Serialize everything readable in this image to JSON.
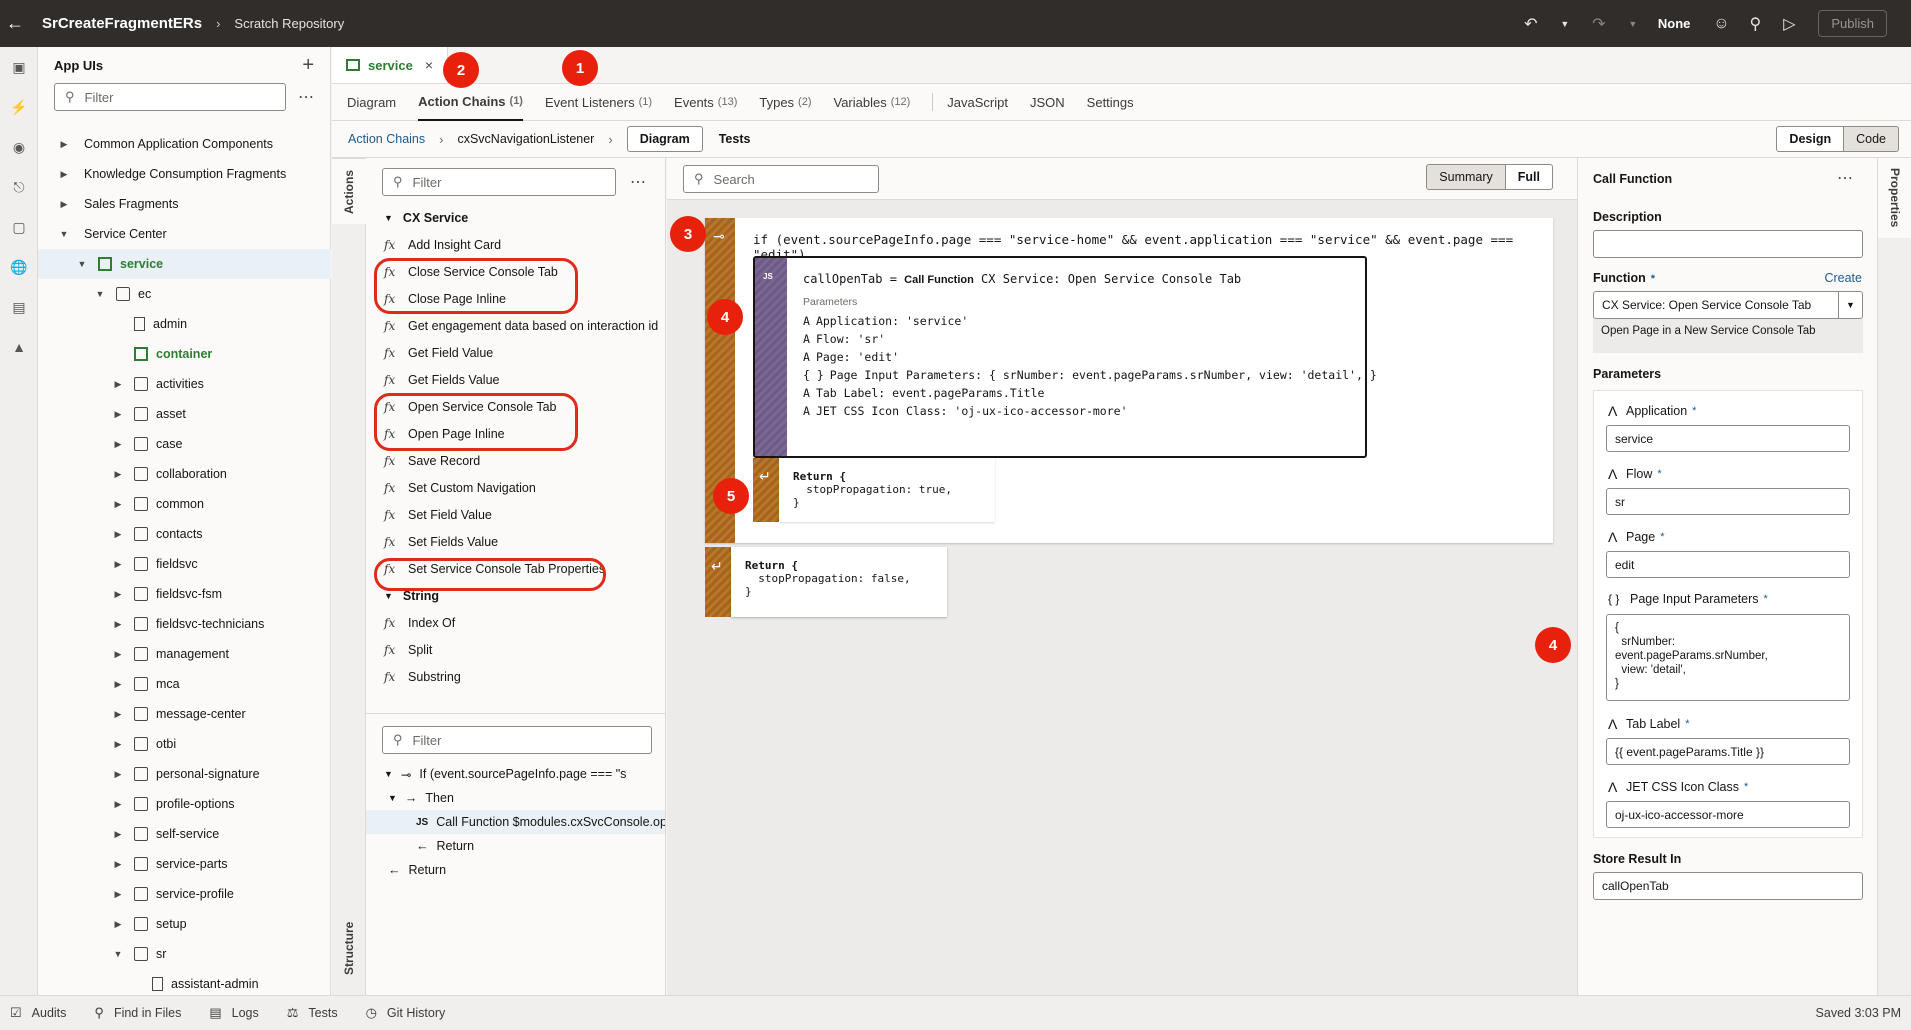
{
  "topbar": {
    "app_name": "SrCreateFragmentERs",
    "repo": "Scratch Repository",
    "none_label": "None",
    "publish_label": "Publish"
  },
  "app_panel": {
    "title": "App UIs",
    "filter_placeholder": "Filter",
    "tree": [
      {
        "label": "Common Application Components",
        "indent": 0
      },
      {
        "label": "Knowledge Consumption Fragments",
        "indent": 0
      },
      {
        "label": "Sales Fragments",
        "indent": 0
      },
      {
        "label": "Service Center",
        "indent": 0
      },
      {
        "label": "service",
        "indent": 1
      },
      {
        "label": "ec",
        "indent": 2
      },
      {
        "label": "admin",
        "indent": 3
      },
      {
        "label": "container",
        "indent": 3
      },
      {
        "label": "activities",
        "indent": 3
      },
      {
        "label": "asset",
        "indent": 3
      },
      {
        "label": "case",
        "indent": 3
      },
      {
        "label": "collaboration",
        "indent": 3
      },
      {
        "label": "common",
        "indent": 3
      },
      {
        "label": "contacts",
        "indent": 3
      },
      {
        "label": "fieldsvc",
        "indent": 3
      },
      {
        "label": "fieldsvc-fsm",
        "indent": 3
      },
      {
        "label": "fieldsvc-technicians",
        "indent": 3
      },
      {
        "label": "management",
        "indent": 3
      },
      {
        "label": "mca",
        "indent": 3
      },
      {
        "label": "message-center",
        "indent": 3
      },
      {
        "label": "otbi",
        "indent": 3
      },
      {
        "label": "personal-signature",
        "indent": 3
      },
      {
        "label": "profile-options",
        "indent": 3
      },
      {
        "label": "self-service",
        "indent": 3
      },
      {
        "label": "service-parts",
        "indent": 3
      },
      {
        "label": "service-profile",
        "indent": 3
      },
      {
        "label": "setup",
        "indent": 3
      },
      {
        "label": "sr",
        "indent": 3
      },
      {
        "label": "assistant-admin",
        "indent": 4
      }
    ]
  },
  "file_tab": {
    "label": "service"
  },
  "subtabs": [
    {
      "label": "Diagram",
      "count": ""
    },
    {
      "label": "Action Chains",
      "count": "(1)"
    },
    {
      "label": "Event Listeners",
      "count": "(1)"
    },
    {
      "label": "Events",
      "count": "(13)"
    },
    {
      "label": "Types",
      "count": "(2)"
    },
    {
      "label": "Variables",
      "count": "(12)"
    },
    {
      "label": "JavaScript",
      "count": ""
    },
    {
      "label": "JSON",
      "count": ""
    },
    {
      "label": "Settings",
      "count": ""
    }
  ],
  "crumbbar": {
    "link": "Action Chains",
    "current": "cxSvcNavigationListener",
    "diagram_btn": "Diagram",
    "tests_label": "Tests",
    "design_label": "Design",
    "code_label": "Code"
  },
  "vtabs": {
    "actions": "Actions",
    "structure": "Structure",
    "properties": "Properties"
  },
  "actions_panel": {
    "filter_placeholder": "Filter",
    "group1": "CX Service",
    "items1": [
      "Add Insight Card",
      "Close Service Console Tab",
      "Close Page Inline",
      "Get engagement data based on interaction id",
      "Get Field Value",
      "Get Fields Value",
      "Open Service Console Tab",
      "Open Page Inline",
      "Save Record",
      "Set Custom Navigation",
      "Set Field Value",
      "Set Fields Value",
      "Set Service Console Tab Properties"
    ],
    "group2": "String",
    "items2": [
      "Index Of",
      "Split",
      "Substring"
    ]
  },
  "structure_panel": {
    "filter_placeholder": "Filter",
    "if_label": "If (event.sourcePageInfo.page === \"s",
    "then_label": "Then",
    "call_label": "Call Function  $modules.cxSvcConsole.ope",
    "return_inner": "Return",
    "return_outer": "Return"
  },
  "canvas": {
    "search_placeholder": "Search",
    "summary_label": "Summary",
    "full_label": "Full",
    "if_code": "if (event.sourcePageInfo.page === \"service-home\" && event.application === \"service\" && event.page === \"edit\")",
    "call_title_var": "callOpenTab = ",
    "call_title_kind": "Call Function",
    "call_title_fn": " CX Service: Open Service Console Tab",
    "params_label": "Parameters",
    "params": [
      {
        "icon": "A",
        "text": "Application: 'service'"
      },
      {
        "icon": "A",
        "text": "Flow: 'sr'"
      },
      {
        "icon": "A",
        "text": "Page: 'edit'"
      },
      {
        "icon": "{ }",
        "text": "Page Input Parameters: { srNumber: event.pageParams.srNumber, view: 'detail', }"
      },
      {
        "icon": "A",
        "text": "Tab Label: event.pageParams.Title"
      },
      {
        "icon": "A",
        "text": "JET CSS Icon Class: 'oj-ux-ico-accessor-more'"
      }
    ],
    "return1_title": "Return {",
    "return1_body": "  stopPropagation: true,",
    "return1_close": "}",
    "return2_title": "Return {",
    "return2_body": "  stopPropagation: false,",
    "return2_close": "}"
  },
  "properties": {
    "title": "Call Function",
    "description_label": "Description",
    "function_label": "Function",
    "create_label": "Create",
    "function_value": "CX Service: Open  Service Console Tab",
    "function_desc": "Open Page in a New Service Console Tab",
    "parameters_label": "Parameters",
    "application_label": "Application",
    "application_value": "service",
    "flow_label": "Flow",
    "flow_value": "sr",
    "page_label": "Page",
    "page_value": "edit",
    "pip_label": "Page Input Parameters",
    "pip_lines": [
      "{",
      "  srNumber:",
      "event.pageParams.srNumber,",
      "  view: 'detail',",
      "}"
    ],
    "tab_label_label": "Tab Label",
    "tab_label_value": "{{ event.pageParams.Title }}",
    "jet_label": "JET CSS Icon Class",
    "jet_value": "oj-ux-ico-accessor-more",
    "store_label": "Store Result In",
    "store_value": "callOpenTab"
  },
  "bottombar": {
    "audits": "Audits",
    "find": "Find in Files",
    "logs": "Logs",
    "tests": "Tests",
    "git": "Git History",
    "saved": "Saved 3:03 PM"
  },
  "annotations": [
    "1",
    "2",
    "3",
    "4",
    "5",
    "4"
  ],
  "colors": {
    "annotation_red": "#e8210d",
    "topbar": "#312d2a",
    "wood": "#a8641c",
    "purple": "#6d5a86"
  }
}
